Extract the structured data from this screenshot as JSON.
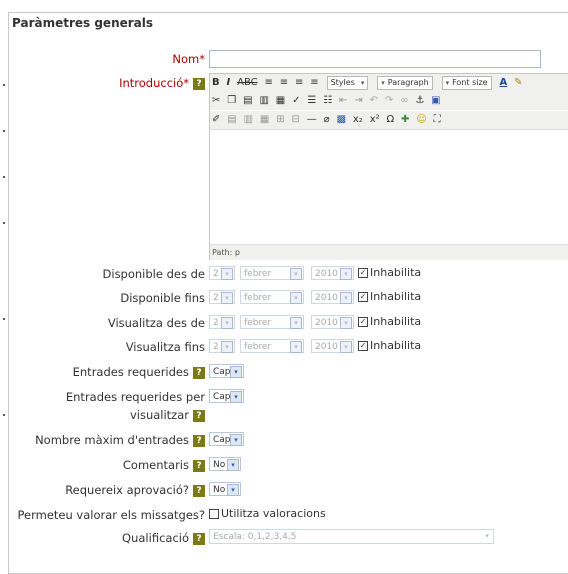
{
  "section": {
    "title": "Paràmetres generals"
  },
  "fields": {
    "nom": {
      "label": "Nom",
      "required_mark": "*",
      "value": ""
    },
    "introduccio": {
      "label": "Introducció",
      "required_mark": "*",
      "help": "?"
    }
  },
  "editor": {
    "styles": "Styles",
    "paragraph": "Paragraph",
    "font_size": "Font size",
    "path": "Path: p"
  },
  "dates": [
    {
      "label": "Disponible des de",
      "day": "2",
      "month": "febrer",
      "year": "2010",
      "disable_label": "Inhabilita",
      "checked": true
    },
    {
      "label": "Disponible fins",
      "day": "2",
      "month": "febrer",
      "year": "2010",
      "disable_label": "Inhabilita",
      "checked": true
    },
    {
      "label": "Visualitza des de",
      "day": "2",
      "month": "febrer",
      "year": "2010",
      "disable_label": "Inhabilita",
      "checked": true
    },
    {
      "label": "Visualitza fins",
      "day": "2",
      "month": "febrer",
      "year": "2010",
      "disable_label": "Inhabilita",
      "checked": true
    }
  ],
  "options": {
    "entrades_requerides": {
      "label": "Entrades requerides",
      "value": "Cap",
      "help": "?"
    },
    "entrades_visualitzar": {
      "label_line1": "Entrades requerides per",
      "label_line2": "visualitzar",
      "value": "Cap",
      "help": "?"
    },
    "nombre_maxim": {
      "label": "Nombre màxim d'entrades",
      "value": "Cap",
      "help": "?"
    },
    "comentaris": {
      "label": "Comentaris",
      "value": "No",
      "help": "?"
    },
    "aprovacio": {
      "label": "Requereix aprovació?",
      "value": "No",
      "help": "?"
    },
    "valorar": {
      "label": "Permeteu valorar els missatges?",
      "checkbox_label": "Utilitza valoracions",
      "checked": false
    },
    "qualificacio": {
      "label": "Qualificació",
      "value": "Escala: 0,1,2,3,4,5",
      "help": "?"
    }
  },
  "icons": {
    "dropdown_arrow": "▾",
    "checkmark": "☑"
  },
  "colors": {
    "required_label": "#aa0000",
    "help_badge": "#7a7a1a",
    "border": "#c8c8c8"
  }
}
